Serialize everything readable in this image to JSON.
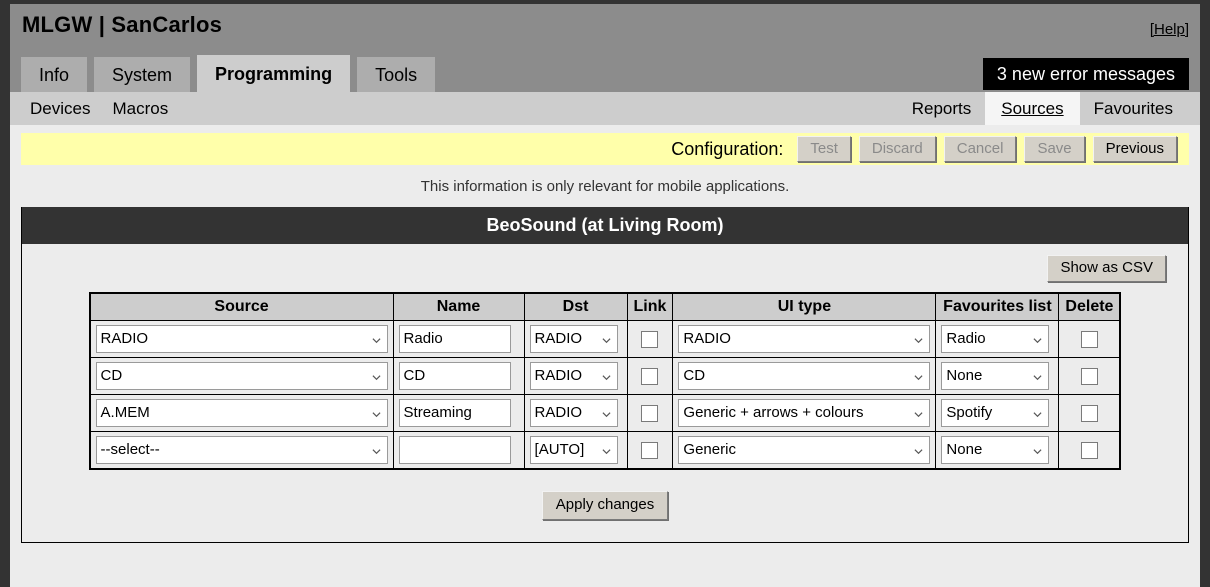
{
  "header": {
    "brand": "MLGW | SanCarlos",
    "help_label": "[Help]",
    "error_banner": "3 new error messages",
    "tabs": [
      {
        "label": "Info",
        "active": false
      },
      {
        "label": "System",
        "active": false
      },
      {
        "label": "Programming",
        "active": true
      },
      {
        "label": "Tools",
        "active": false
      }
    ]
  },
  "subnav": {
    "left": [
      {
        "label": "Devices",
        "active": false
      },
      {
        "label": "Macros",
        "active": false
      }
    ],
    "right": [
      {
        "label": "Reports",
        "active": false
      },
      {
        "label": "Sources",
        "active": true
      },
      {
        "label": "Favourites",
        "active": false
      }
    ]
  },
  "config_bar": {
    "label": "Configuration:",
    "buttons": [
      {
        "label": "Test",
        "disabled": true
      },
      {
        "label": "Discard",
        "disabled": true
      },
      {
        "label": "Cancel",
        "disabled": true
      },
      {
        "label": "Save",
        "disabled": true
      },
      {
        "label": "Previous",
        "disabled": false
      }
    ]
  },
  "info_note": "This information is only relevant for mobile applications.",
  "panel": {
    "title": "BeoSound (at Living Room)",
    "csv_button": "Show as CSV",
    "apply_button": "Apply changes",
    "columns": [
      "Source",
      "Name",
      "Dst",
      "Link",
      "UI type",
      "Favourites list",
      "Delete"
    ],
    "rows": [
      {
        "source": "RADIO",
        "name": "Radio",
        "dst": "RADIO",
        "link": false,
        "ui_type": "RADIO",
        "favourites": "Radio",
        "delete": false
      },
      {
        "source": "CD",
        "name": "CD",
        "dst": "RADIO",
        "link": false,
        "ui_type": "CD",
        "favourites": "None",
        "delete": false
      },
      {
        "source": "A.MEM",
        "name": "Streaming",
        "dst": "RADIO",
        "link": false,
        "ui_type": "Generic + arrows + colours",
        "favourites": "Spotify",
        "delete": false
      },
      {
        "source": "--select--",
        "name": "",
        "dst": "[AUTO]",
        "link": false,
        "ui_type": "Generic",
        "favourites": "None",
        "delete": false
      }
    ]
  },
  "colors": {
    "page_background": "#333333",
    "content_background": "#ececec",
    "header_grey": "#8c8c8c",
    "subnav_grey": "#cdcdcd",
    "tab_active": "#cdcdcd",
    "tab_inactive": "#adadad",
    "config_yellow": "#ffffaa",
    "panel_title_dark": "#333333",
    "error_banner": "#000000"
  }
}
